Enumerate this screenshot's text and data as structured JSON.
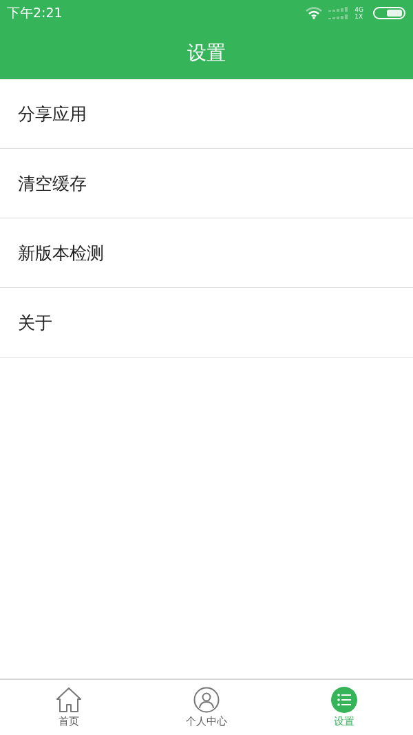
{
  "status_bar": {
    "time": "下午2:21",
    "network_top": "4G",
    "network_bottom": "1X"
  },
  "header": {
    "title": "设置"
  },
  "menu": [
    {
      "label": "分享应用"
    },
    {
      "label": "清空缓存"
    },
    {
      "label": "新版本检测"
    },
    {
      "label": "关于"
    }
  ],
  "tabs": [
    {
      "label": "首页",
      "kind": "home",
      "selected": false
    },
    {
      "label": "个人中心",
      "kind": "profile",
      "selected": false
    },
    {
      "label": "设置",
      "kind": "list",
      "selected": true
    }
  ]
}
